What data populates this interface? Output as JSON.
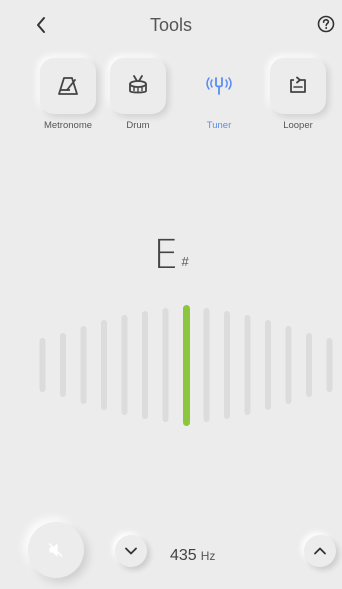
{
  "header": {
    "title": "Tools",
    "back_icon": "chevron-left-icon",
    "help_icon": "question-circle-icon"
  },
  "tools": [
    {
      "label": "Metronome",
      "icon": "metronome-icon",
      "active": false
    },
    {
      "label": "Drum",
      "icon": "drum-icon",
      "active": false
    },
    {
      "label": "Tuner",
      "icon": "tuning-fork-icon",
      "active": true
    },
    {
      "label": "Looper",
      "icon": "loop-icon",
      "active": false
    }
  ],
  "tuner": {
    "note": "E",
    "accidental": "#",
    "needle_color": "#8cc63f",
    "bar_color": "#dcdcdc"
  },
  "reference": {
    "value": "435",
    "unit": "Hz"
  },
  "colors": {
    "accent": "#5b8cf0",
    "background": "#ececec"
  }
}
